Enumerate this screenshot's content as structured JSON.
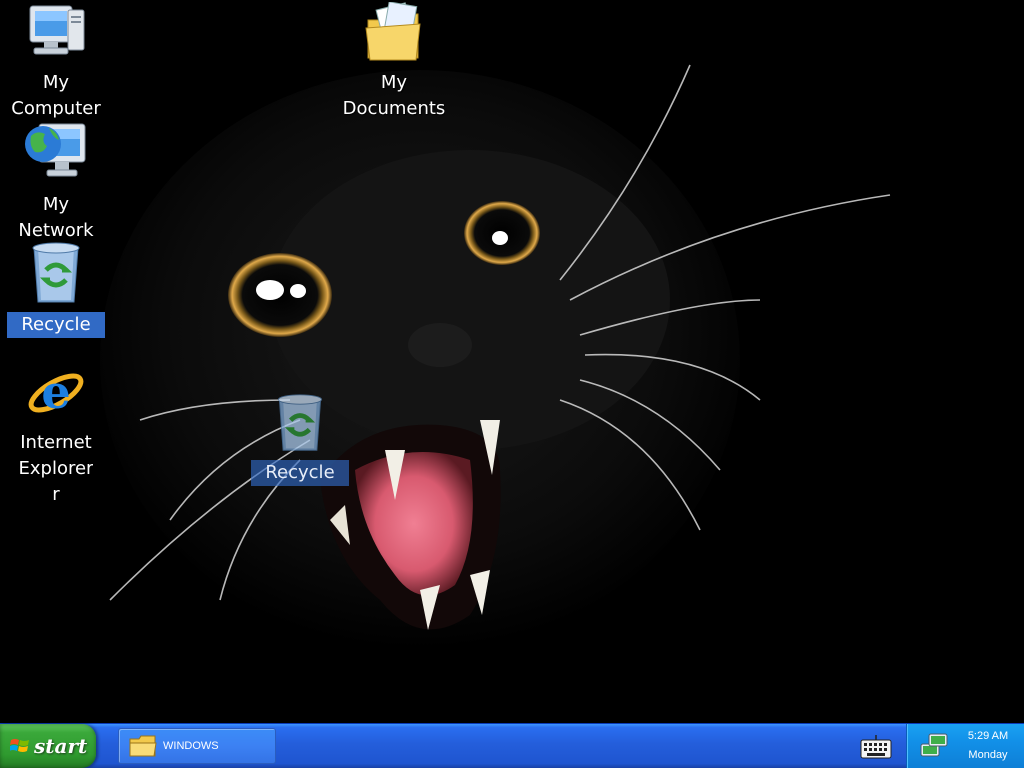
{
  "desktop": {
    "icons": {
      "my_computer": {
        "label": "My\nComputer",
        "icon": "my-computer-icon"
      },
      "my_documents": {
        "label": "My\nDocuments",
        "icon": "my-documents-icon"
      },
      "my_network_places": {
        "label": "My\nNetwork Pl...",
        "icon": "network-places-icon"
      },
      "recycle_bin": {
        "label": "Recycle",
        "icon": "recycle-bin-icon",
        "selected": true
      },
      "internet_explorer": {
        "label": "Internet\nExplorer\nr",
        "icon": "internet-explorer-icon"
      },
      "recycle_bin_drag": {
        "label": "Recycle",
        "icon": "recycle-bin-icon"
      }
    },
    "wallpaper": "black cat with open mouth, glowing amber eyes"
  },
  "taskbar": {
    "start_label": "start",
    "start_icon": "windows-flag-icon",
    "tasks": [
      {
        "label": "WINDOWS",
        "icon": "folder-icon"
      }
    ],
    "tray": {
      "keyboard_icon": "on-screen-keyboard-icon",
      "network_icon": "network-tray-icon",
      "time": "5:29 AM",
      "day": "Monday"
    }
  },
  "colors": {
    "selection": "#316ac5",
    "taskbar": "#245edb",
    "start_button": "#3aa83a",
    "tray": "#0f8bde"
  }
}
